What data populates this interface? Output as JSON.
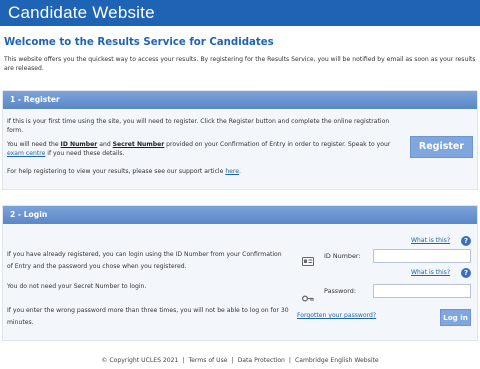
{
  "header": {
    "title": "Candidate Website"
  },
  "welcome": {
    "heading": "Welcome to the Results Service for Candidates"
  },
  "intro": {
    "text": "This website offers you the quickest way to access your results. By registering for the Results Service, you will be notified by email as soon as your results are released."
  },
  "register": {
    "heading": "1 - Register",
    "para1": "If this is your first time using the site, you will need to register. Click the Register button and complete the online registration form.",
    "para2_prefix": "You will need the ",
    "id_number": "ID Number",
    "para2_and": " and ",
    "secret_number": "Secret Number",
    "para2_mid": " provided on your Confirmation of Entry in order to register. Speak to your ",
    "exam_centre_link": "exam centre",
    "para2_suffix": " if you need these details.",
    "para3_prefix": "For help registering to view your results, please see our support article ",
    "here_link": "here",
    "para3_suffix": ".",
    "button_label": "Register"
  },
  "login": {
    "heading": "2 - Login",
    "para1": "If you have already registered, you can login using the ID Number from your Confirmation of Entry and the password you chose when you registered.",
    "para2": "You do not need your Secret Number to login.",
    "para3": "If you enter the wrong password more than three times, you will not be able to log on for 30 minutes.",
    "what_is_this": "What is this?",
    "id_label": "ID Number:",
    "password_label": "Password:",
    "id_value": "",
    "password_value": "",
    "forgotten_link": "Forgotten your password?",
    "login_button": "Log in"
  },
  "footer": {
    "copyright": "© Copyright UCLES 2021",
    "terms": "Terms of Use",
    "data_protection": "Data Protection",
    "cambridge": "Cambridge English Website"
  },
  "colors": {
    "brand": "#1f63b5",
    "panel_header": "#6a94d0",
    "button": "#7fa6de"
  },
  "icons": {
    "help": "question-circle-icon",
    "id": "id-card-icon",
    "password": "key-icon"
  }
}
